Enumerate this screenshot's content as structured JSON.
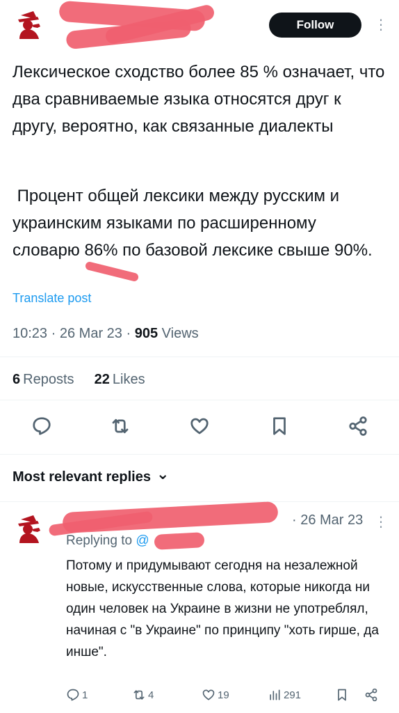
{
  "header": {
    "follow_label": "Follow",
    "kebab_glyph": "⋮"
  },
  "tweet": {
    "paragraph1": "Лексическое сходство более 85 % означает, что два сравниваемые языка относятся друг к другу, вероятно, как связанные диалекты",
    "paragraph2": " Процент общей лексики между русским и украинским языками по расширенному словарю 86% по базовой лексике свыше 90%.",
    "translate_label": "Translate post",
    "time": "10:23",
    "date": "26 Mar 23",
    "views_count": "905",
    "views_label": "Views",
    "sep": "·"
  },
  "stats": {
    "reposts_count": "6",
    "reposts_label": "Reposts",
    "likes_count": "22",
    "likes_label": "Likes"
  },
  "actions": [
    "reply-icon",
    "repost-icon",
    "like-icon",
    "bookmark-icon",
    "share-icon"
  ],
  "replies_section": {
    "title": "Most relevant replies",
    "chevron": "⌄"
  },
  "reply": {
    "date_text": "· 26 Mar 23",
    "replying_label": "Replying to",
    "replying_handle": "@",
    "text": "Потому и придумывают сегодня на незалежной новые, искусственные слова, которые никогда ни один человек на Украине в жизни не употреблял, начиная с \"в Украине\" по принципу \"хоть гирше, да инше\".",
    "reply_count": "1",
    "repost_count": "4",
    "like_count": "19",
    "views_count": "291"
  },
  "colors": {
    "accent": "#1d9bf0",
    "text": "#0f1419",
    "muted": "#536471",
    "redaction": "#f0606f",
    "avatar": "#b3141f"
  }
}
